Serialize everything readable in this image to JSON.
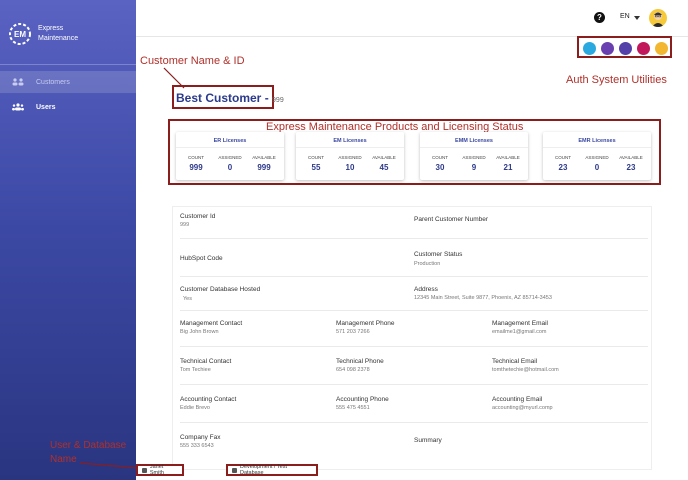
{
  "sidebar": {
    "brand_line1": "Express",
    "brand_line2": "Maintenance",
    "items": [
      {
        "label": "Customers",
        "icon": "customers-icon"
      },
      {
        "label": "Users",
        "icon": "users-icon"
      }
    ]
  },
  "topbar": {
    "help": "?",
    "lang": "EN"
  },
  "annotations": {
    "customer_name_id": "Customer Name & ID",
    "auth_utilities": "Auth System Utilities",
    "products_licensing": "Express Maintenance Products and Licensing Status",
    "user_database": "User & Database",
    "user_database_2": "Name"
  },
  "customer": {
    "name": "Best Customer - ",
    "id": "999"
  },
  "licenses": [
    {
      "title": "ER Licenses",
      "count": "999",
      "assigned": "0",
      "available": "999"
    },
    {
      "title": "EM Licenses",
      "count": "55",
      "assigned": "10",
      "available": "45"
    },
    {
      "title": "EMM Licenses",
      "count": "30",
      "assigned": "9",
      "available": "21"
    },
    {
      "title": "EMR Licenses",
      "count": "23",
      "assigned": "0",
      "available": "23"
    }
  ],
  "license_labels": {
    "count": "COUNT",
    "assigned": "ASSIGNED",
    "available": "AVAILABLE"
  },
  "details": {
    "customer_id_label": "Customer Id",
    "customer_id_value": "999",
    "parent_label": "Parent Customer Number",
    "hubspot_label": "HubSpot Code",
    "status_label": "Customer Status",
    "status_value": "Production",
    "db_hosted_label": "Customer Database Hosted",
    "db_hosted_value": "Yes",
    "address_label": "Address",
    "address_value": "12345 Main Street, Suite 9877, Phoenix, AZ 85714-3453",
    "mgmt_contact_label": "Management Contact",
    "mgmt_contact_value": "Big John Brown",
    "mgmt_phone_label": "Management Phone",
    "mgmt_phone_value": "571 203 7266",
    "mgmt_email_label": "Management Email",
    "mgmt_email_value": "emailme1@gmail.com",
    "tech_contact_label": "Technical Contact",
    "tech_contact_value": "Tom Techiee",
    "tech_phone_label": "Technical Phone",
    "tech_phone_value": "654 098 2378",
    "tech_email_label": "Technical Email",
    "tech_email_value": "tomthetechie@hotmail.com",
    "acct_contact_label": "Accounting Contact",
    "acct_contact_value": "Eddie Brevo",
    "acct_phone_label": "Accounting Phone",
    "acct_phone_value": "555 475 4551",
    "acct_email_label": "Accounting Email",
    "acct_email_value": "accounting@myurl.comp",
    "fax_label": "Company Fax",
    "fax_value": "555 333 6543",
    "summary_label": "Summary"
  },
  "footer": {
    "user": "Janet Smith",
    "database": "Development / Test Database"
  },
  "colors": {
    "accent": "#3a48a0",
    "annotation": "#b0302a",
    "util1": "#2aa9e0",
    "util2": "#6a3fb0",
    "util3": "#5340a8",
    "util4": "#c2185b",
    "util5": "#f2b630"
  }
}
